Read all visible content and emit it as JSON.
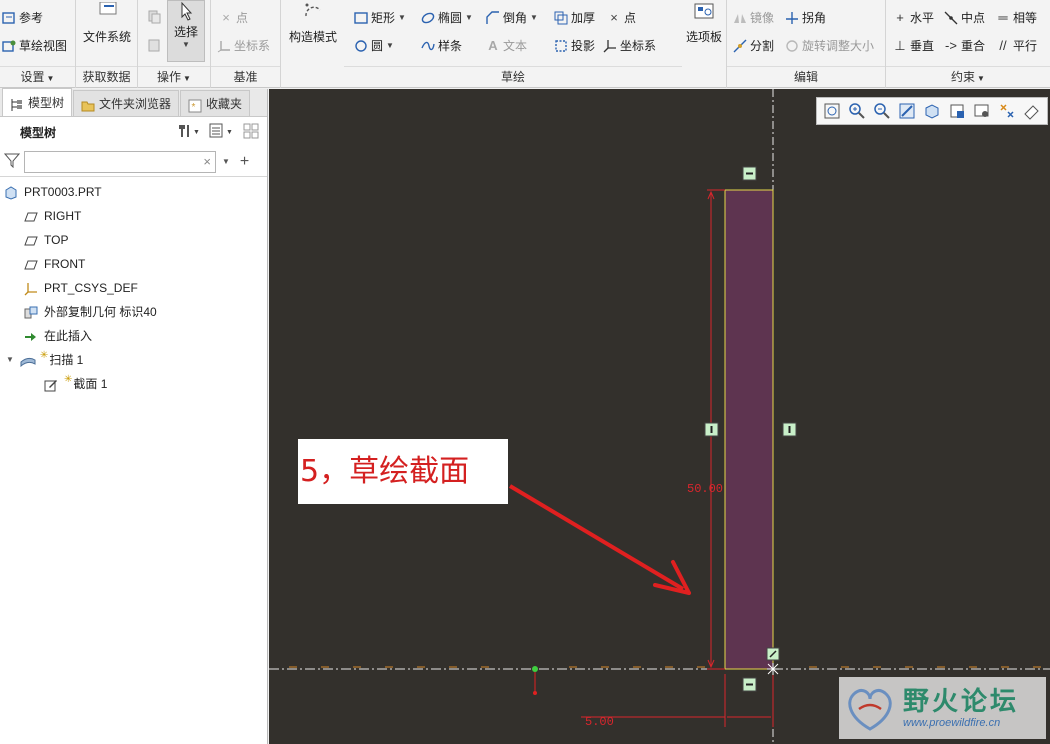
{
  "ribbon": {
    "setup": {
      "label": "设置",
      "reference": "参考",
      "sketch_view": "草绘视图"
    },
    "getdata": {
      "label": "获取数据",
      "file_system": "文件系统"
    },
    "operations": {
      "label": "操作",
      "select": "选择"
    },
    "datum": {
      "label": "基准",
      "point": "点",
      "csys": "坐标系"
    },
    "construction_mode": "构造模式",
    "sketch": {
      "label": "草绘",
      "rectangle": "矩形",
      "ellipse": "椭圆",
      "chamfer": "倒角",
      "thicken": "加厚",
      "point": "点",
      "circle": "圆",
      "spline": "样条",
      "text": "文本",
      "project": "投影",
      "csys": "坐标系"
    },
    "palette": "选项板",
    "edit": {
      "label": "编辑",
      "mirror": "镜像",
      "corner": "拐角",
      "divide": "分割",
      "rotate_resize": "旋转调整大小"
    },
    "constrain": {
      "label": "约束",
      "horizontal": "水平",
      "midpoint": "中点",
      "equal": "相等",
      "vertical": "垂直",
      "coincident": "重合",
      "parallel": "平行"
    }
  },
  "panel": {
    "tabs": [
      "模型树",
      "文件夹浏览器",
      "收藏夹"
    ],
    "tree_title": "模型树",
    "search_placeholder": "",
    "items": [
      {
        "label": "PRT0003.PRT",
        "icon": "part-icon"
      },
      {
        "label": "RIGHT",
        "icon": "datum-plane-icon"
      },
      {
        "label": "TOP",
        "icon": "datum-plane-icon"
      },
      {
        "label": "FRONT",
        "icon": "datum-plane-icon"
      },
      {
        "label": "PRT_CSYS_DEF",
        "icon": "csys-icon"
      },
      {
        "label": "外部复制几何 标识40",
        "icon": "external-copy-geom-icon"
      },
      {
        "label": "在此插入",
        "icon": "insert-here-arrow-icon"
      },
      {
        "label": "扫描 1",
        "icon": "sweep-icon"
      },
      {
        "label": "截面 1",
        "icon": "section-sketch-icon"
      }
    ]
  },
  "viewport": {
    "dimension_height": "50.00",
    "dimension_width": "5.00",
    "callout_text": "5，草绘截面",
    "watermark_cn": "野火论坛",
    "watermark_url": "www.proewildfire.cn"
  },
  "colors": {
    "viewport_bg": "#33302c",
    "rect_fill": "#5e3450",
    "rect_edge": "#e6d84a",
    "dimension": "#d8262c",
    "arrow": "#e02020",
    "axis": "#f0f0f0"
  }
}
